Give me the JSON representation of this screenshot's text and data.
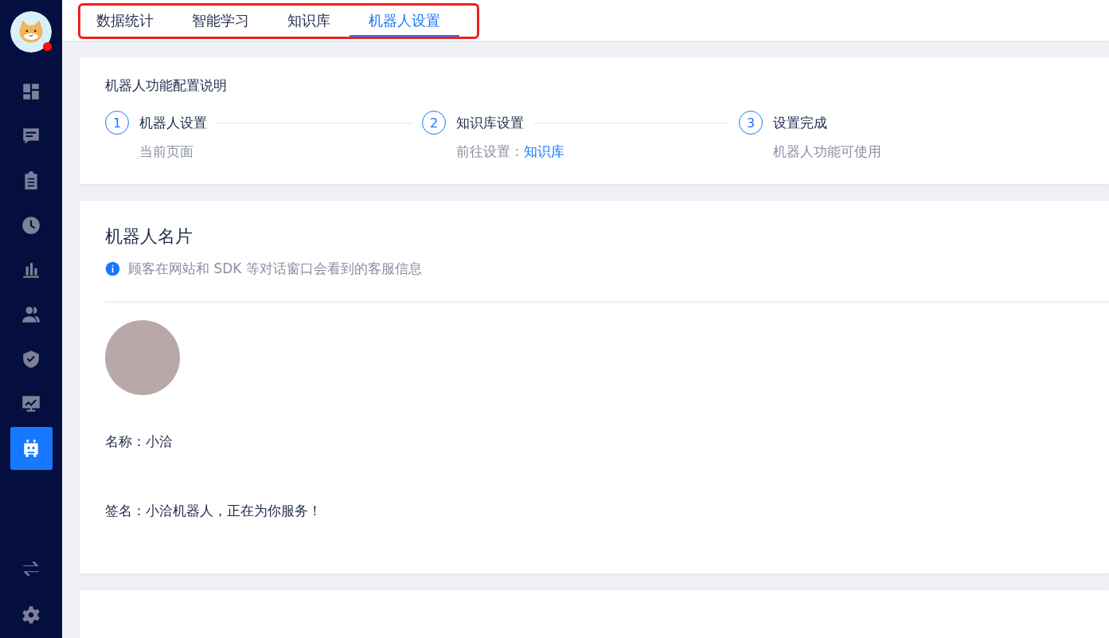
{
  "sidebar": {
    "user": {
      "badge": true
    },
    "items": [
      {
        "selected": false
      },
      {
        "selected": false
      },
      {
        "selected": false
      },
      {
        "selected": false
      },
      {
        "selected": false
      },
      {
        "selected": false
      },
      {
        "selected": false
      },
      {
        "selected": false
      },
      {
        "selected": true
      }
    ]
  },
  "tabs": [
    {
      "label": "数据统计",
      "selected": false
    },
    {
      "label": "智能学习",
      "selected": false
    },
    {
      "label": "知识库",
      "selected": false
    },
    {
      "label": "机器人设置",
      "selected": true
    }
  ],
  "guide": {
    "title": "机器人功能配置说明",
    "steps": [
      {
        "number": "1",
        "title": "机器人设置",
        "description": "当前页面"
      },
      {
        "number": "2",
        "title": "知识库设置",
        "description": "前往设置：",
        "link": "知识库"
      },
      {
        "number": "3",
        "title": "设置完成",
        "description": "机器人功能可使用"
      }
    ]
  },
  "card": {
    "title": "机器人名片",
    "info": "顾客在网站和 SDK 等对话窗口会看到的客服信息",
    "name": "名称：小洽",
    "signature": "签名：小洽机器人，正在为你服务！"
  }
}
